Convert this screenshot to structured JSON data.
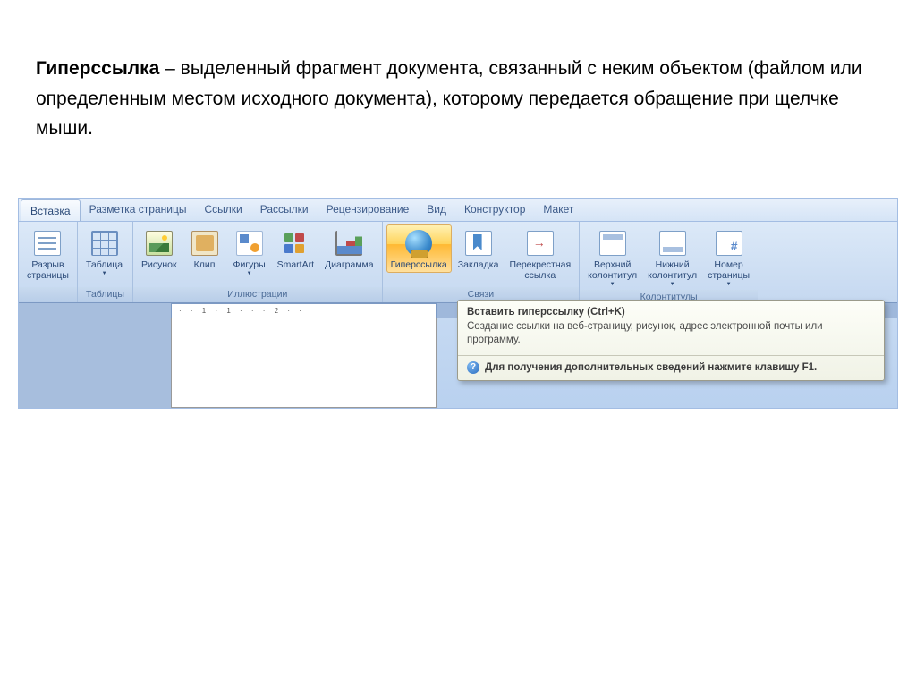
{
  "definition": {
    "term": "Гиперссылка",
    "text": " – выделенный фрагмент документа, связанный с неким объектом (файлом или определенным местом исходного документа), которому передается обращение при щелчке мыши."
  },
  "tabs": [
    "Вставка",
    "Разметка страницы",
    "Ссылки",
    "Рассылки",
    "Рецензирование",
    "Вид",
    "Конструктор",
    "Макет"
  ],
  "active_tab": 0,
  "groups": {
    "pages": {
      "title": "",
      "items": [
        {
          "label": "Разрыв\nстраницы",
          "name": "page-break-button"
        }
      ]
    },
    "tables": {
      "title": "Таблицы",
      "items": [
        {
          "label": "Таблица",
          "name": "table-button",
          "dropdown": true
        }
      ]
    },
    "illustrations": {
      "title": "Иллюстрации",
      "items": [
        {
          "label": "Рисунок",
          "name": "picture-button"
        },
        {
          "label": "Клип",
          "name": "clip-button"
        },
        {
          "label": "Фигуры",
          "name": "shapes-button",
          "dropdown": true
        },
        {
          "label": "SmartArt",
          "name": "smartart-button"
        },
        {
          "label": "Диаграмма",
          "name": "chart-button"
        }
      ]
    },
    "links": {
      "title": "Связи",
      "items": [
        {
          "label": "Гиперссылка",
          "name": "hyperlink-button",
          "active": true
        },
        {
          "label": "Закладка",
          "name": "bookmark-button"
        },
        {
          "label": "Перекрестная\nссылка",
          "name": "cross-ref-button"
        }
      ]
    },
    "headerfooter": {
      "title": "Колонтитулы",
      "items": [
        {
          "label": "Верхний\nколонтитул",
          "name": "header-button",
          "dropdown": true
        },
        {
          "label": "Нижний\nколонтитул",
          "name": "footer-button",
          "dropdown": true
        },
        {
          "label": "Номер\nстраницы",
          "name": "page-number-button",
          "dropdown": true
        }
      ]
    }
  },
  "ruler_marks": "· · 1 · 1 · · · 2 · ·",
  "tooltip": {
    "title": "Вставить гиперссылку (Ctrl+K)",
    "body": "Создание ссылки на веб-страницу, рисунок, адрес электронной почты или программу.",
    "footer": "Для получения дополнительных сведений нажмите клавишу F1."
  }
}
